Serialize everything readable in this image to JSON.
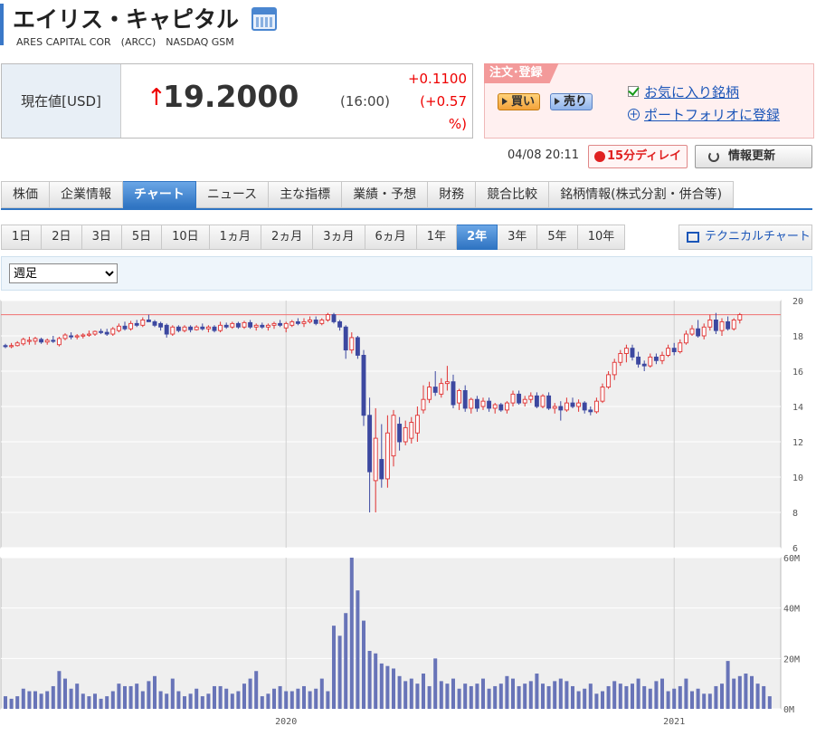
{
  "header": {
    "title": "エイリス・キャピタル",
    "subtitle": "ARES CAPITAL COR　(ARCC)　NASDAQ GSM"
  },
  "quote": {
    "label": "現在値[USD]",
    "price": "19.2000",
    "time": "(16:00)",
    "change": "+0.1100",
    "change_pct_line1": "(+0.57",
    "change_pct_line2": "%)",
    "updated": "04/08 20:11",
    "delay": "15分ディレイ",
    "refresh": "情報更新"
  },
  "order": {
    "tag": "注文･登録",
    "buy": "買い",
    "sell": "売り",
    "favorite": "お気に入り銘柄",
    "portfolio": "ポートフォリオに登録"
  },
  "main_tabs": [
    "株価",
    "企業情報",
    "チャート",
    "ニュース",
    "主な指標",
    "業績・予想",
    "財務",
    "競合比較",
    "銘柄情報(株式分割・併合等)"
  ],
  "range_tabs": [
    "1日",
    "2日",
    "3日",
    "5日",
    "10日",
    "1ヵ月",
    "2ヵ月",
    "3ヵ月",
    "6ヵ月",
    "1年",
    "2年",
    "3年",
    "5年",
    "10年"
  ],
  "technical": "テクニカルチャート",
  "period": {
    "selected": "週足"
  },
  "colors": {
    "up": "#e03030",
    "down": "#3c48a0",
    "volume": "#6874b8",
    "accent": "#2f74c2"
  },
  "chart_data": [
    {
      "type": "candlestick",
      "ylim": [
        6,
        20
      ],
      "yticks": [
        6,
        8,
        10,
        12,
        14,
        16,
        18,
        20
      ],
      "reference_line": 19.2,
      "x_labels": [
        {
          "label": "2020",
          "index": 47
        },
        {
          "label": "2021",
          "index": 112
        }
      ],
      "candles": [
        {
          "o": 17.45,
          "h": 17.55,
          "l": 17.3,
          "c": 17.4
        },
        {
          "o": 17.4,
          "h": 17.6,
          "l": 17.3,
          "c": 17.45
        },
        {
          "o": 17.45,
          "h": 17.7,
          "l": 17.4,
          "c": 17.6
        },
        {
          "o": 17.55,
          "h": 17.9,
          "l": 17.45,
          "c": 17.8
        },
        {
          "o": 17.7,
          "h": 17.95,
          "l": 17.5,
          "c": 17.75
        },
        {
          "o": 17.7,
          "h": 17.95,
          "l": 17.5,
          "c": 17.85
        },
        {
          "o": 17.8,
          "h": 17.9,
          "l": 17.55,
          "c": 17.65
        },
        {
          "o": 17.65,
          "h": 17.85,
          "l": 17.5,
          "c": 17.75
        },
        {
          "o": 17.75,
          "h": 18.0,
          "l": 17.6,
          "c": 17.7
        },
        {
          "o": 17.5,
          "h": 17.95,
          "l": 17.4,
          "c": 17.85
        },
        {
          "o": 17.85,
          "h": 18.15,
          "l": 17.75,
          "c": 18.05
        },
        {
          "o": 18.0,
          "h": 18.2,
          "l": 17.8,
          "c": 17.95
        },
        {
          "o": 17.95,
          "h": 18.1,
          "l": 17.8,
          "c": 18.0
        },
        {
          "o": 18.0,
          "h": 18.15,
          "l": 17.85,
          "c": 18.05
        },
        {
          "o": 18.05,
          "h": 18.3,
          "l": 17.95,
          "c": 18.1
        },
        {
          "o": 18.1,
          "h": 18.3,
          "l": 18.0,
          "c": 18.25
        },
        {
          "o": 18.25,
          "h": 18.4,
          "l": 18.1,
          "c": 18.2
        },
        {
          "o": 18.2,
          "h": 18.4,
          "l": 18.0,
          "c": 18.1
        },
        {
          "o": 18.1,
          "h": 18.5,
          "l": 18.0,
          "c": 18.4
        },
        {
          "o": 18.3,
          "h": 18.7,
          "l": 18.2,
          "c": 18.55
        },
        {
          "o": 18.55,
          "h": 18.8,
          "l": 18.3,
          "c": 18.4
        },
        {
          "o": 18.4,
          "h": 18.85,
          "l": 18.3,
          "c": 18.7
        },
        {
          "o": 18.7,
          "h": 18.9,
          "l": 18.5,
          "c": 18.6
        },
        {
          "o": 18.6,
          "h": 19.05,
          "l": 18.5,
          "c": 18.9
        },
        {
          "o": 18.9,
          "h": 19.2,
          "l": 18.8,
          "c": 18.8
        },
        {
          "o": 18.8,
          "h": 18.9,
          "l": 18.5,
          "c": 18.6
        },
        {
          "o": 18.7,
          "h": 18.8,
          "l": 18.3,
          "c": 18.5
        },
        {
          "o": 18.6,
          "h": 18.7,
          "l": 17.9,
          "c": 18.1
        },
        {
          "o": 18.1,
          "h": 18.6,
          "l": 18.0,
          "c": 18.5
        },
        {
          "o": 18.5,
          "h": 18.6,
          "l": 18.2,
          "c": 18.3
        },
        {
          "o": 18.3,
          "h": 18.6,
          "l": 18.2,
          "c": 18.5
        },
        {
          "o": 18.5,
          "h": 18.6,
          "l": 18.2,
          "c": 18.35
        },
        {
          "o": 18.35,
          "h": 18.6,
          "l": 18.3,
          "c": 18.5
        },
        {
          "o": 18.5,
          "h": 18.7,
          "l": 18.3,
          "c": 18.4
        },
        {
          "o": 18.4,
          "h": 18.6,
          "l": 18.2,
          "c": 18.5
        },
        {
          "o": 18.5,
          "h": 18.6,
          "l": 18.2,
          "c": 18.3
        },
        {
          "o": 18.3,
          "h": 18.8,
          "l": 18.2,
          "c": 18.6
        },
        {
          "o": 18.6,
          "h": 18.75,
          "l": 18.4,
          "c": 18.5
        },
        {
          "o": 18.5,
          "h": 18.8,
          "l": 18.4,
          "c": 18.7
        },
        {
          "o": 18.7,
          "h": 18.8,
          "l": 18.4,
          "c": 18.5
        },
        {
          "o": 18.5,
          "h": 18.85,
          "l": 18.4,
          "c": 18.75
        },
        {
          "o": 18.75,
          "h": 18.9,
          "l": 18.4,
          "c": 18.5
        },
        {
          "o": 18.5,
          "h": 18.7,
          "l": 18.3,
          "c": 18.6
        },
        {
          "o": 18.6,
          "h": 18.75,
          "l": 18.4,
          "c": 18.5
        },
        {
          "o": 18.5,
          "h": 18.7,
          "l": 18.3,
          "c": 18.6
        },
        {
          "o": 18.6,
          "h": 18.8,
          "l": 18.4,
          "c": 18.7
        },
        {
          "o": 18.7,
          "h": 18.9,
          "l": 18.5,
          "c": 18.6
        },
        {
          "o": 18.45,
          "h": 18.8,
          "l": 18.2,
          "c": 18.7
        },
        {
          "o": 18.6,
          "h": 18.9,
          "l": 18.5,
          "c": 18.8
        },
        {
          "o": 18.8,
          "h": 19.0,
          "l": 18.6,
          "c": 18.7
        },
        {
          "o": 18.7,
          "h": 19.0,
          "l": 18.5,
          "c": 18.8
        },
        {
          "o": 18.8,
          "h": 19.1,
          "l": 18.7,
          "c": 18.9
        },
        {
          "o": 18.9,
          "h": 19.1,
          "l": 18.6,
          "c": 18.7
        },
        {
          "o": 18.7,
          "h": 19.0,
          "l": 18.6,
          "c": 18.9
        },
        {
          "o": 18.9,
          "h": 19.3,
          "l": 18.8,
          "c": 19.2
        },
        {
          "o": 19.2,
          "h": 19.3,
          "l": 18.7,
          "c": 18.8
        },
        {
          "o": 18.8,
          "h": 18.9,
          "l": 18.3,
          "c": 18.5
        },
        {
          "o": 18.5,
          "h": 18.6,
          "l": 16.7,
          "c": 17.2
        },
        {
          "o": 17.2,
          "h": 18.2,
          "l": 17.0,
          "c": 17.9
        },
        {
          "o": 17.9,
          "h": 18.0,
          "l": 16.7,
          "c": 16.9
        },
        {
          "o": 16.9,
          "h": 17.2,
          "l": 12.9,
          "c": 13.5
        },
        {
          "o": 13.5,
          "h": 14.5,
          "l": 8.0,
          "c": 10.3
        },
        {
          "o": 9.8,
          "h": 13.9,
          "l": 8.0,
          "c": 12.2
        },
        {
          "o": 11.0,
          "h": 13.0,
          "l": 9.4,
          "c": 9.9
        },
        {
          "o": 9.9,
          "h": 13.5,
          "l": 9.4,
          "c": 12.5
        },
        {
          "o": 11.2,
          "h": 13.8,
          "l": 10.6,
          "c": 13.5
        },
        {
          "o": 13.0,
          "h": 13.4,
          "l": 11.5,
          "c": 12.0
        },
        {
          "o": 12.0,
          "h": 13.2,
          "l": 11.8,
          "c": 12.8
        },
        {
          "o": 12.2,
          "h": 13.4,
          "l": 11.9,
          "c": 13.1
        },
        {
          "o": 12.5,
          "h": 14.0,
          "l": 12.0,
          "c": 13.5
        },
        {
          "o": 13.8,
          "h": 15.2,
          "l": 13.6,
          "c": 14.4
        },
        {
          "o": 14.4,
          "h": 15.4,
          "l": 14.2,
          "c": 15.1
        },
        {
          "o": 15.1,
          "h": 16.0,
          "l": 14.6,
          "c": 14.8
        },
        {
          "o": 14.7,
          "h": 15.6,
          "l": 14.5,
          "c": 15.3
        },
        {
          "o": 15.3,
          "h": 16.3,
          "l": 14.9,
          "c": 15.4
        },
        {
          "o": 15.4,
          "h": 15.8,
          "l": 13.9,
          "c": 14.1
        },
        {
          "o": 14.2,
          "h": 15.0,
          "l": 13.8,
          "c": 14.9
        },
        {
          "o": 14.9,
          "h": 15.2,
          "l": 13.7,
          "c": 13.9
        },
        {
          "o": 13.9,
          "h": 14.5,
          "l": 13.6,
          "c": 14.4
        },
        {
          "o": 14.4,
          "h": 14.6,
          "l": 13.7,
          "c": 13.9
        },
        {
          "o": 14.0,
          "h": 14.5,
          "l": 13.8,
          "c": 14.3
        },
        {
          "o": 14.3,
          "h": 14.5,
          "l": 13.7,
          "c": 13.9
        },
        {
          "o": 13.9,
          "h": 14.2,
          "l": 13.6,
          "c": 14.1
        },
        {
          "o": 14.1,
          "h": 14.2,
          "l": 13.7,
          "c": 13.8
        },
        {
          "o": 13.8,
          "h": 14.3,
          "l": 13.6,
          "c": 14.2
        },
        {
          "o": 14.2,
          "h": 14.9,
          "l": 14.0,
          "c": 14.7
        },
        {
          "o": 14.7,
          "h": 14.9,
          "l": 14.1,
          "c": 14.2
        },
        {
          "o": 14.2,
          "h": 14.6,
          "l": 14.0,
          "c": 14.4
        },
        {
          "o": 14.4,
          "h": 14.8,
          "l": 14.2,
          "c": 14.6
        },
        {
          "o": 14.6,
          "h": 14.8,
          "l": 13.9,
          "c": 14.0
        },
        {
          "o": 14.0,
          "h": 14.7,
          "l": 13.9,
          "c": 14.6
        },
        {
          "o": 14.6,
          "h": 14.8,
          "l": 13.8,
          "c": 13.9
        },
        {
          "o": 13.9,
          "h": 14.2,
          "l": 13.6,
          "c": 14.0
        },
        {
          "o": 14.0,
          "h": 14.3,
          "l": 13.2,
          "c": 13.8
        },
        {
          "o": 13.8,
          "h": 14.5,
          "l": 13.7,
          "c": 14.2
        },
        {
          "o": 14.2,
          "h": 14.5,
          "l": 13.9,
          "c": 14.0
        },
        {
          "o": 14.0,
          "h": 14.4,
          "l": 13.7,
          "c": 14.2
        },
        {
          "o": 14.2,
          "h": 14.3,
          "l": 13.6,
          "c": 13.8
        },
        {
          "o": 13.8,
          "h": 14.0,
          "l": 13.5,
          "c": 13.7
        },
        {
          "o": 13.7,
          "h": 14.5,
          "l": 13.6,
          "c": 14.3
        },
        {
          "o": 14.3,
          "h": 15.3,
          "l": 14.2,
          "c": 15.1
        },
        {
          "o": 15.1,
          "h": 16.0,
          "l": 15.0,
          "c": 15.8
        },
        {
          "o": 15.8,
          "h": 16.7,
          "l": 15.5,
          "c": 16.5
        },
        {
          "o": 16.5,
          "h": 17.2,
          "l": 16.3,
          "c": 17.0
        },
        {
          "o": 17.0,
          "h": 17.5,
          "l": 16.5,
          "c": 17.3
        },
        {
          "o": 17.3,
          "h": 17.5,
          "l": 16.6,
          "c": 16.8
        },
        {
          "o": 16.8,
          "h": 17.1,
          "l": 16.2,
          "c": 16.4
        },
        {
          "o": 16.4,
          "h": 16.6,
          "l": 16.0,
          "c": 16.3
        },
        {
          "o": 16.3,
          "h": 17.0,
          "l": 16.2,
          "c": 16.8
        },
        {
          "o": 16.8,
          "h": 17.0,
          "l": 16.4,
          "c": 16.6
        },
        {
          "o": 16.6,
          "h": 17.1,
          "l": 16.4,
          "c": 16.9
        },
        {
          "o": 16.9,
          "h": 17.5,
          "l": 16.8,
          "c": 17.3
        },
        {
          "o": 17.3,
          "h": 17.6,
          "l": 16.9,
          "c": 17.1
        },
        {
          "o": 17.1,
          "h": 17.8,
          "l": 17.0,
          "c": 17.6
        },
        {
          "o": 17.6,
          "h": 18.3,
          "l": 17.5,
          "c": 18.1
        },
        {
          "o": 18.1,
          "h": 18.6,
          "l": 18.0,
          "c": 18.4
        },
        {
          "o": 18.4,
          "h": 18.9,
          "l": 17.9,
          "c": 18.0
        },
        {
          "o": 18.0,
          "h": 18.7,
          "l": 17.8,
          "c": 18.5
        },
        {
          "o": 18.5,
          "h": 19.2,
          "l": 18.3,
          "c": 18.9
        },
        {
          "o": 18.9,
          "h": 19.3,
          "l": 18.1,
          "c": 18.3
        },
        {
          "o": 18.3,
          "h": 19.0,
          "l": 18.0,
          "c": 18.8
        },
        {
          "o": 18.8,
          "h": 19.1,
          "l": 18.3,
          "c": 18.4
        },
        {
          "o": 18.4,
          "h": 19.0,
          "l": 18.3,
          "c": 18.9
        },
        {
          "o": 18.9,
          "h": 19.3,
          "l": 18.7,
          "c": 19.2
        }
      ]
    },
    {
      "type": "bar",
      "ylim": [
        0,
        60
      ],
      "ytick_labels": [
        "0M",
        "20M",
        "40M",
        "60M"
      ],
      "values": [
        5,
        4,
        5,
        8,
        7,
        7,
        6,
        7,
        9,
        15,
        12,
        8,
        10,
        6,
        5,
        6,
        4,
        5,
        7,
        10,
        9,
        9,
        10,
        7,
        11,
        13,
        7,
        6,
        12,
        7,
        5,
        6,
        8,
        5,
        6,
        9,
        9,
        8,
        6,
        7,
        10,
        12,
        15,
        5,
        6,
        8,
        9,
        7,
        7,
        8,
        9,
        7,
        8,
        12,
        7,
        33,
        29,
        38,
        60,
        47,
        35,
        23,
        22,
        18,
        17,
        16,
        13,
        11,
        12,
        10,
        14,
        9,
        20,
        11,
        10,
        12,
        8,
        10,
        9,
        10,
        12,
        8,
        9,
        10,
        13,
        12,
        9,
        10,
        11,
        14,
        10,
        9,
        11,
        12,
        11,
        9,
        7,
        8,
        10,
        6,
        7,
        9,
        11,
        10,
        9,
        10,
        12,
        9,
        8,
        11,
        12,
        7,
        8,
        9,
        12,
        7,
        8,
        6,
        6,
        9,
        10,
        19,
        12,
        13,
        14,
        13,
        10,
        9,
        5
      ]
    }
  ]
}
